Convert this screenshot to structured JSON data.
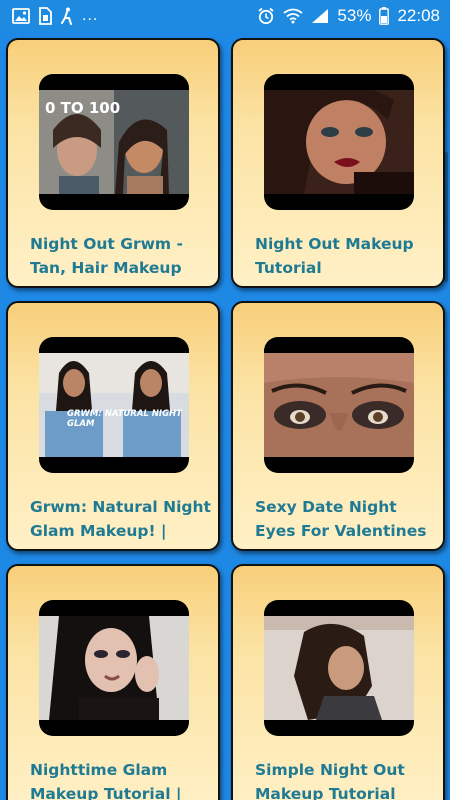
{
  "status_bar": {
    "left_icons": [
      "image-icon",
      "sim-card-icon",
      "accessibility-icon"
    ],
    "overflow": "...",
    "right_icons": [
      "alarm-icon",
      "wifi-icon",
      "signal-icon"
    ],
    "battery_percent": "53%",
    "time": "22:08"
  },
  "videos": [
    {
      "title": "Night Out Grwm - Tan, Hair Makeup",
      "thumbnail_caption": "0 TO 100"
    },
    {
      "title": "Night Out Makeup Tutorial",
      "thumbnail_caption": ""
    },
    {
      "title": "Grwm: Natural Night Glam Makeup! | Maria",
      "thumbnail_caption": "GRWM: NATURAL NIGHT GLAM"
    },
    {
      "title": "Sexy Date Night Eyes For Valentines Day -",
      "thumbnail_caption": ""
    },
    {
      "title": "Nighttime Glam Makeup Tutorial |",
      "thumbnail_caption": ""
    },
    {
      "title": "Simple Night Out Makeup Tutorial",
      "thumbnail_caption": ""
    }
  ],
  "colors": {
    "background": "#1e88e5",
    "card_top": "#f8cf7a",
    "card_bottom": "#fff0c6",
    "title_text": "#1f7a93"
  }
}
